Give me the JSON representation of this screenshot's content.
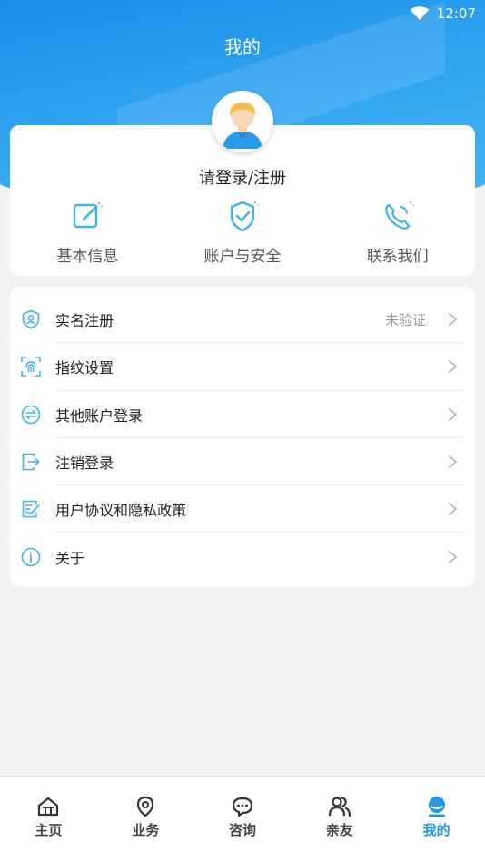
{
  "status_bar": {
    "time": "12:07",
    "wifi_icon": "wifi-icon"
  },
  "header": {
    "title": "我的"
  },
  "profile": {
    "login_prompt": "请登录/注册",
    "avatar_icon": "user-avatar-icon"
  },
  "quick_actions": [
    {
      "label": "基本信息",
      "icon": "edit-icon"
    },
    {
      "label": "账户与安全",
      "icon": "shield-check-icon"
    },
    {
      "label": "联系我们",
      "icon": "phone-icon"
    }
  ],
  "menu": [
    {
      "label": "实名注册",
      "value": "未验证",
      "icon": "id-shield-icon"
    },
    {
      "label": "指纹设置",
      "value": "",
      "icon": "fingerprint-icon"
    },
    {
      "label": "其他账户登录",
      "value": "",
      "icon": "switch-account-icon"
    },
    {
      "label": "注销登录",
      "value": "",
      "icon": "logout-icon"
    },
    {
      "label": "用户协议和隐私政策",
      "value": "",
      "icon": "agreement-icon"
    },
    {
      "label": "关于",
      "value": "",
      "icon": "info-icon"
    }
  ],
  "tabs": [
    {
      "label": "主页",
      "icon": "home-icon",
      "active": false
    },
    {
      "label": "业务",
      "icon": "location-icon",
      "active": false
    },
    {
      "label": "咨询",
      "icon": "chat-icon",
      "active": false
    },
    {
      "label": "亲友",
      "icon": "friends-icon",
      "active": false
    },
    {
      "label": "我的",
      "icon": "me-icon",
      "active": true
    }
  ],
  "colors": {
    "primary": "#1f96e8",
    "icon_accent": "#3fb3e6",
    "background": "#f2f2f2"
  }
}
